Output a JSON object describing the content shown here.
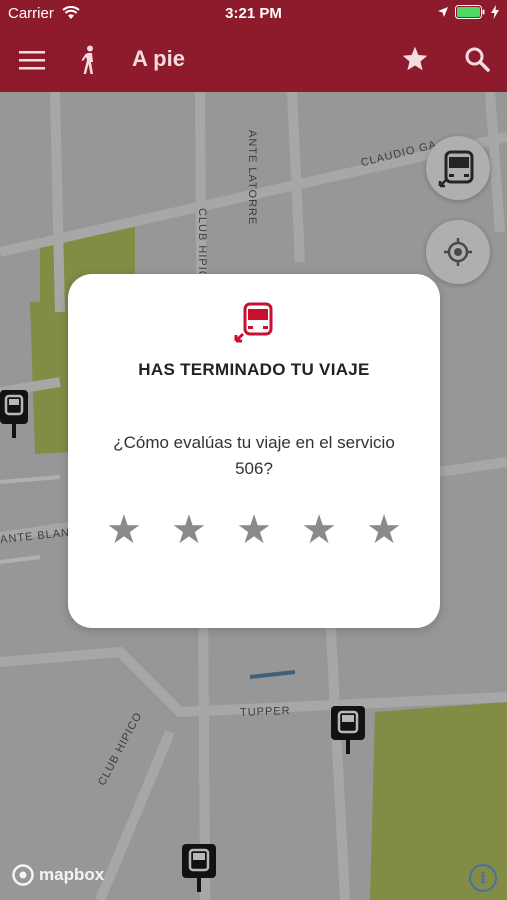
{
  "status_bar": {
    "carrier": "Carrier",
    "time": "3:21 PM"
  },
  "nav": {
    "title": "A pie"
  },
  "map": {
    "street_labels": [
      "CLAUDIO GA",
      "ANTE LATORRE",
      "CLUB HIPIC",
      "ANTE BLANC",
      "TUPPER",
      "CLUB HIPICO"
    ],
    "attribution": "mapbox",
    "info_label": "i"
  },
  "modal": {
    "headline": "HAS TERMINADO TU VIAJE",
    "question": "¿Cómo evalúas tu viaje en el servicio 506?",
    "rating_stars": 5,
    "star_glyph": "★"
  },
  "colors": {
    "brand": "#8e1b2c",
    "star": "#8a8a8a",
    "bus_icon": "#c8102e"
  }
}
